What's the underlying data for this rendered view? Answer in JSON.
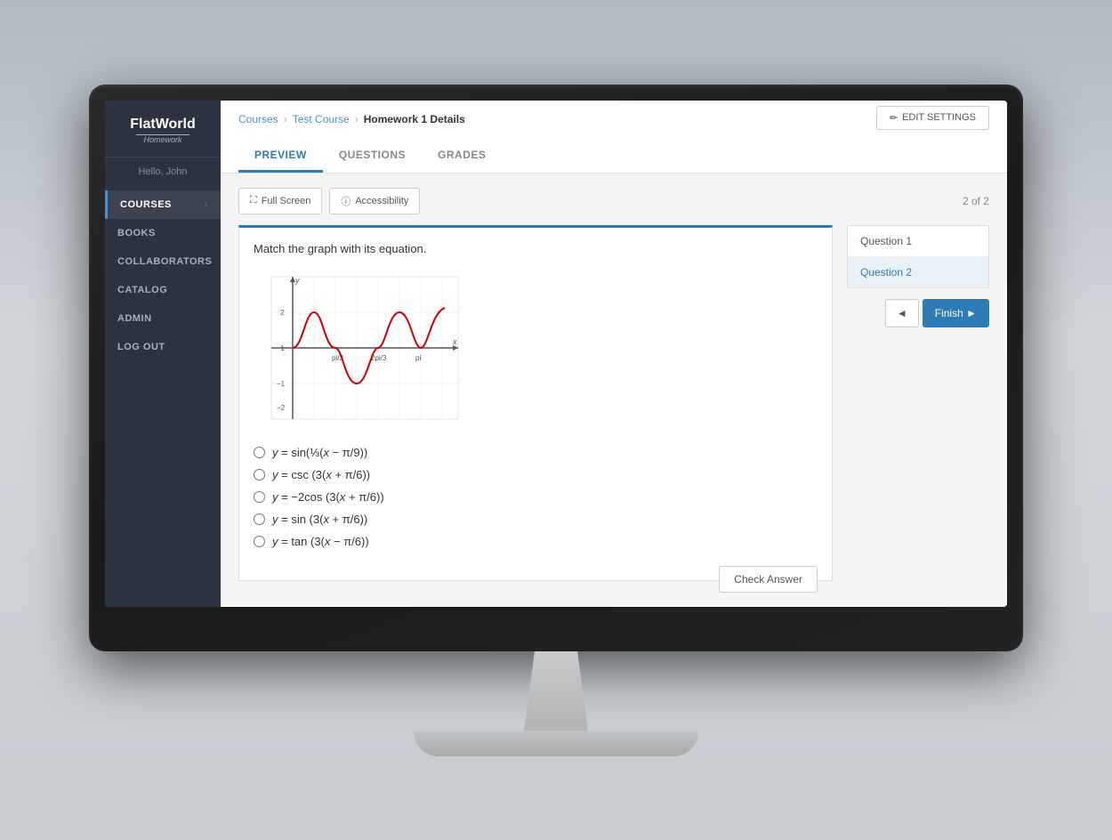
{
  "app": {
    "logo_name": "FlatWorld",
    "logo_sub": "Homework",
    "user_greeting": "Hello, John"
  },
  "sidebar": {
    "items": [
      {
        "id": "courses",
        "label": "COURSES",
        "active": true,
        "has_chevron": true
      },
      {
        "id": "books",
        "label": "BOOKS",
        "active": false,
        "has_chevron": false
      },
      {
        "id": "collaborators",
        "label": "COLLABORATORS",
        "active": false,
        "has_chevron": false
      },
      {
        "id": "catalog",
        "label": "CATALOG",
        "active": false,
        "has_chevron": false
      },
      {
        "id": "admin",
        "label": "ADMIN",
        "active": false,
        "has_chevron": false
      },
      {
        "id": "logout",
        "label": "LOG OUT",
        "active": false,
        "has_chevron": false
      }
    ]
  },
  "breadcrumb": {
    "items": [
      "Courses",
      "Test Course",
      "Homework 1 Details"
    ]
  },
  "edit_settings_label": "EDIT SETTINGS",
  "tabs": [
    {
      "id": "preview",
      "label": "PREVIEW",
      "active": true
    },
    {
      "id": "questions",
      "label": "QUESTIONS",
      "active": false
    },
    {
      "id": "grades",
      "label": "GRADES",
      "active": false
    }
  ],
  "toolbar": {
    "fullscreen_label": "Full Screen",
    "accessibility_label": "Accessibility",
    "question_counter": "2 of 2"
  },
  "question": {
    "text": "Match the graph with its equation.",
    "answers": [
      {
        "id": "a1",
        "latex": "y = sin(¹⁄₃ (x − π/9))"
      },
      {
        "id": "a2",
        "latex": "y = csc (3 (x + π/6))"
      },
      {
        "id": "a3",
        "latex": "y = −2cos (3 (x + π/6))"
      },
      {
        "id": "a4",
        "latex": "y = sin (3 (x + π/6))"
      },
      {
        "id": "a5",
        "latex": "y = tan (3 (x − π/6))"
      }
    ],
    "check_answer_label": "Check Answer"
  },
  "question_nav": {
    "items": [
      {
        "label": "Question 1",
        "active": false
      },
      {
        "label": "Question 2",
        "active": true
      }
    ],
    "prev_label": "◄",
    "finish_label": "Finish ►"
  }
}
